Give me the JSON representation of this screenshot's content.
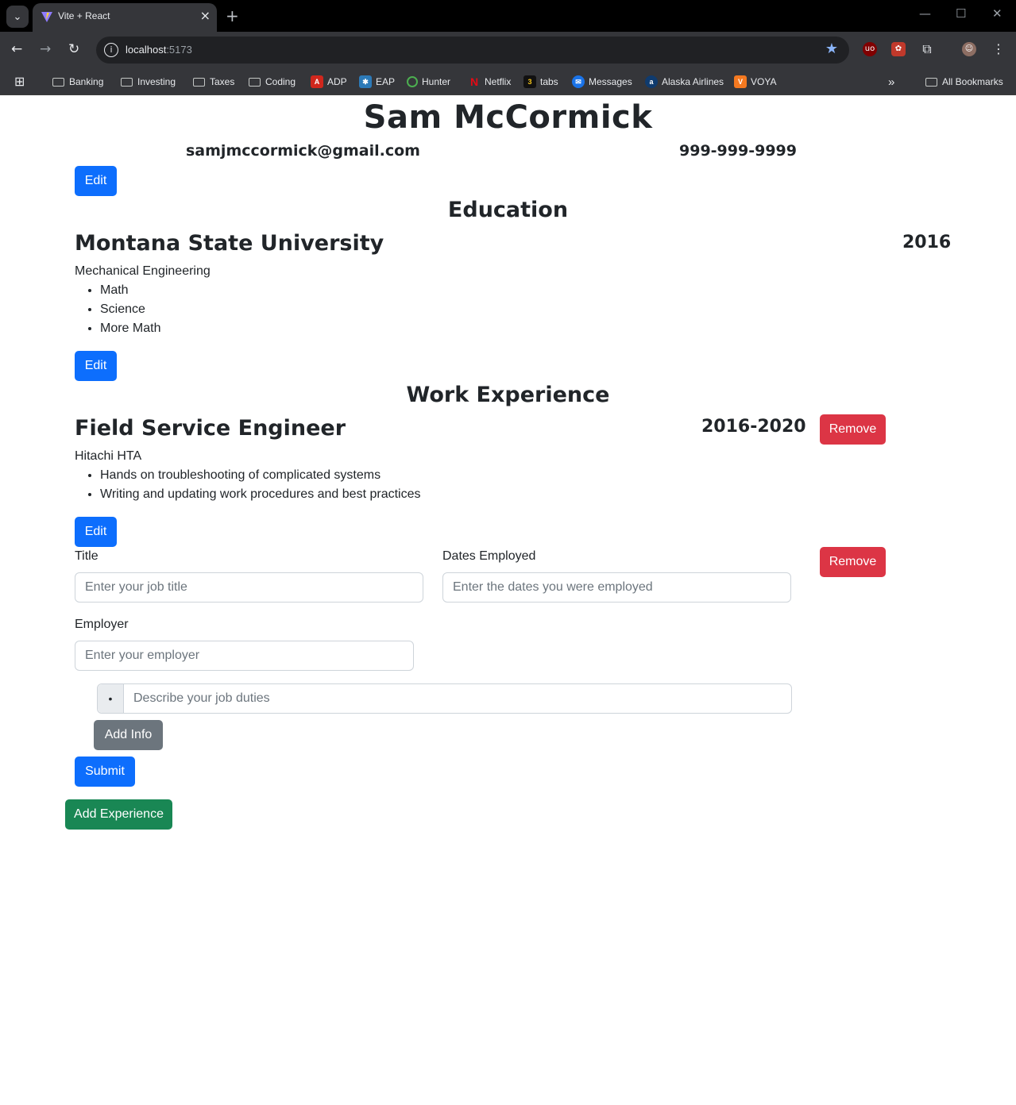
{
  "browser": {
    "tab_title": "Vite + React",
    "url_host": "localhost",
    "url_port": ":5173",
    "bookmarks": [
      {
        "label": "Banking",
        "icon": "folder-icon"
      },
      {
        "label": "Investing",
        "icon": "folder-icon"
      },
      {
        "label": "Taxes",
        "icon": "folder-icon"
      },
      {
        "label": "Coding",
        "icon": "folder-icon"
      },
      {
        "label": "ADP",
        "icon": "adp-icon"
      },
      {
        "label": "EAP",
        "icon": "eap-icon"
      },
      {
        "label": "Hunter",
        "icon": "hunter-icon"
      },
      {
        "label": "Netflix",
        "icon": "netflix-icon"
      },
      {
        "label": "tabs",
        "icon": "tabs-icon"
      },
      {
        "label": "Messages",
        "icon": "messages-icon"
      },
      {
        "label": "Alaska Airlines",
        "icon": "alaska-icon"
      },
      {
        "label": "VOYA",
        "icon": "voya-icon"
      }
    ],
    "all_bookmarks": "All Bookmarks"
  },
  "header": {
    "name": "Sam McCormick",
    "email": "samjmccormick@gmail.com",
    "phone": "999-999-9999",
    "edit_label": "Edit"
  },
  "education": {
    "section_title": "Education",
    "school": "Montana State University",
    "year": "2016",
    "degree": "Mechanical Engineering",
    "courses": [
      "Math",
      "Science",
      "More Math"
    ],
    "edit_label": "Edit"
  },
  "work": {
    "section_title": "Work Experience",
    "jobs": [
      {
        "title": "Field Service Engineer",
        "dates": "2016-2020",
        "employer": "Hitachi HTA",
        "duties": [
          "Hands on troubleshooting of complicated systems",
          "Writing and updating work procedures and best practices"
        ],
        "edit_label": "Edit",
        "remove_label": "Remove"
      }
    ],
    "form": {
      "title_label": "Title",
      "title_placeholder": "Enter your job title",
      "dates_label": "Dates Employed",
      "dates_placeholder": "Enter the dates you were employed",
      "employer_label": "Employer",
      "employer_placeholder": "Enter your employer",
      "bullet": "•",
      "duties_placeholder": "Describe your job duties",
      "add_info_label": "Add Info",
      "submit_label": "Submit",
      "remove_label": "Remove"
    },
    "add_experience_label": "Add Experience"
  },
  "colors": {
    "primary": "#0d6efd",
    "danger": "#dc3545",
    "secondary": "#6c757d",
    "success": "#198754"
  }
}
